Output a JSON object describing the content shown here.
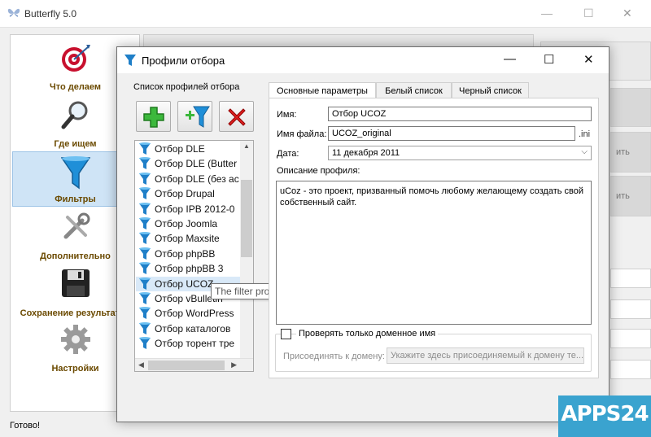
{
  "main_window": {
    "title": "Butterfly 5.0",
    "status": "Готово!",
    "sidebar": [
      {
        "label": "Что делаем",
        "icon": "target-icon"
      },
      {
        "label": "Где ищем",
        "icon": "magnifier-icon"
      },
      {
        "label": "Фильтры",
        "icon": "funnel-icon",
        "selected": true
      },
      {
        "label": "Дополнительно",
        "icon": "tools-icon"
      },
      {
        "label": "Сохранение результатов",
        "icon": "floppy-disk-icon"
      },
      {
        "label": "Настройки",
        "icon": "gear-icon"
      }
    ],
    "background_fragments": [
      "ить",
      "ить"
    ]
  },
  "dialog": {
    "title": "Профили отбора",
    "left_label": "Список профилей отбора",
    "toolbar": {
      "add_icon": "plus-icon",
      "add_filter_icon": "add-funnel-icon",
      "delete_icon": "red-x-icon"
    },
    "profiles": [
      "Отбор DLE",
      "Отбор DLE (Butter",
      "Отбор DLE (без ас",
      "Отбор Drupal",
      "Отбор IPB 2012-0",
      "Отбор Joomla",
      "Отбор Maxsite",
      "Отбор phpBB",
      "Отбор phpBB 3",
      "Отбор UCOZ",
      "Отбор vBulletin",
      "Отбор WordPress",
      "Отбор каталогов",
      "Отбор торент тре"
    ],
    "selected_profile": "Отбор UCOZ",
    "tooltip": "The filter profile list",
    "tabs": [
      "Основные параметры",
      "Белый список",
      "Черный список"
    ],
    "form": {
      "name_label": "Имя:",
      "name_value": "Отбор UCOZ",
      "file_label": "Имя файла:",
      "file_value": "UCOZ_original",
      "file_ext": ".ini",
      "date_label": "Дата:",
      "date_value": "11 декабря 2011",
      "desc_label": "Описание профиля:",
      "desc_value": "uCoz - это проект, призванный помочь любому желающему создать свой собственный сайт.",
      "domain_only_label": "Проверять только доменное имя",
      "join_label": "Присоединять к домену:",
      "join_placeholder": "Укажите здесь присоединяемый к домену те..."
    }
  },
  "watermark": "APPS24",
  "colors": {
    "accent": "#3aa3cf",
    "selection": "#cfe4f6",
    "funnel": "#1f7fc8",
    "sidebar_label": "#6b4a00"
  }
}
